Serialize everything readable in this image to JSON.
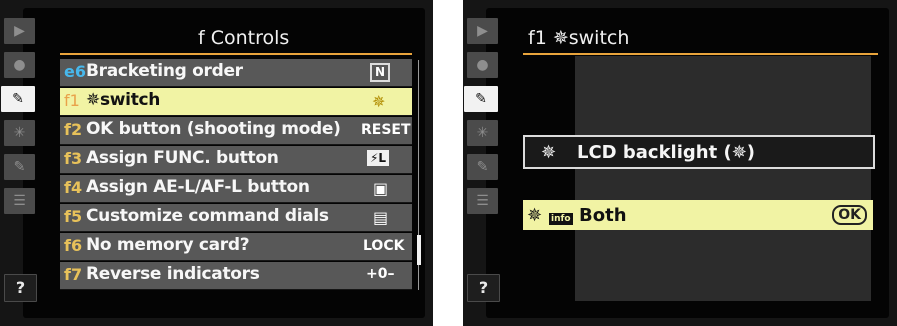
{
  "left": {
    "title": "f  Controls",
    "rail_icons": [
      "playback-tab-icon",
      "shooting-tab-icon",
      "pencil-icon",
      "wrench-icon",
      "retouch-icon",
      "my-menu-icon"
    ],
    "help": "?",
    "rows": [
      {
        "code": "e6",
        "label": "Bracketing order",
        "value": "N"
      },
      {
        "code": "f1",
        "label": "✵switch",
        "value": "✵"
      },
      {
        "code": "f2",
        "label": "OK button (shooting mode)",
        "value": "RESET"
      },
      {
        "code": "f3",
        "label": "Assign FUNC. button",
        "value": "⚡L"
      },
      {
        "code": "f4",
        "label": "Assign AE-L/AF-L button",
        "value": "▣"
      },
      {
        "code": "f5",
        "label": "Customize command dials",
        "value": "▤"
      },
      {
        "code": "f6",
        "label": "No memory card?",
        "value": "LOCK"
      },
      {
        "code": "f7",
        "label": "Reverse indicators",
        "value": "+0–"
      }
    ]
  },
  "right": {
    "title": "f1 ✵switch",
    "help": "?",
    "options": [
      {
        "icon": "✵",
        "label": "LCD backlight (✵)"
      },
      {
        "icon": "✵",
        "badge": "info",
        "label": "Both",
        "ok": "OK"
      }
    ]
  }
}
